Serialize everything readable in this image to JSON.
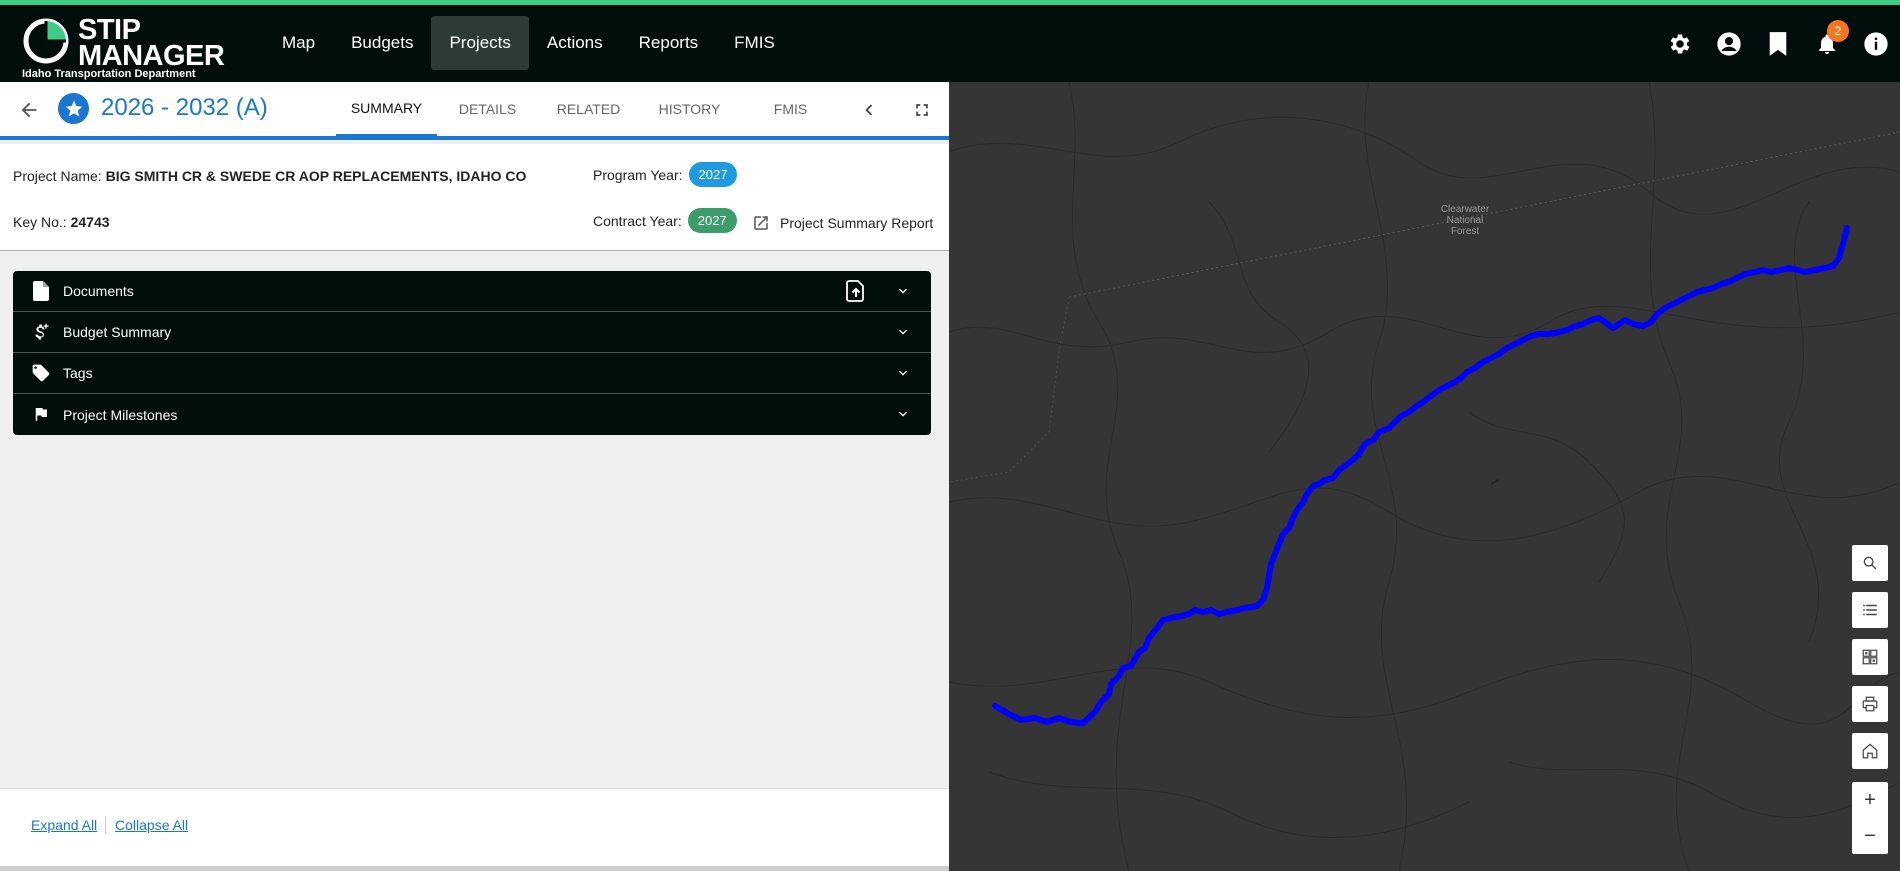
{
  "app": {
    "logo_line1": "STIP",
    "logo_line2": "MANAGER",
    "logo_sub": "Idaho Transportation Department"
  },
  "nav": {
    "items": [
      {
        "label": "Map"
      },
      {
        "label": "Budgets"
      },
      {
        "label": "Projects"
      },
      {
        "label": "Actions"
      },
      {
        "label": "Reports"
      },
      {
        "label": "FMIS"
      }
    ],
    "active": "Projects",
    "notifications_count": "2"
  },
  "project": {
    "title": "2026 - 2032 (A)",
    "tabs": [
      "SUMMARY",
      "DETAILS",
      "RELATED",
      "HISTORY",
      "FMIS"
    ],
    "active_tab": "SUMMARY",
    "name_label": "Project Name:",
    "name_value": "BIG SMITH CR & SWEDE CR AOP REPLACEMENTS, IDAHO CO",
    "key_label": "Key No.:",
    "key_value": "24743",
    "program_year_label": "Program Year:",
    "program_year": "2027",
    "contract_year_label": "Contract Year:",
    "contract_year": "2027",
    "report_link": "Project Summary Report"
  },
  "sections": [
    {
      "label": "Documents",
      "icon": "file-icon"
    },
    {
      "label": "Budget Summary",
      "icon": "dollar-icon"
    },
    {
      "label": "Tags",
      "icon": "tag-icon"
    },
    {
      "label": "Project Milestones",
      "icon": "flag-icon"
    }
  ],
  "footer": {
    "expand_all": "Expand All",
    "collapse_all": "Collapse All"
  },
  "map": {
    "label_1": "Clearwater",
    "label_2": "National",
    "label_3": "Forest"
  },
  "colors": {
    "brand_green": "#3ecb86",
    "nav_bg": "#020e0c",
    "accent_blue": "#1976d2",
    "program_year_pill": "#1e9be0",
    "contract_year_pill": "#3a9d6a",
    "route_blue": "#0000ff",
    "badge_orange": "#f7761d"
  }
}
